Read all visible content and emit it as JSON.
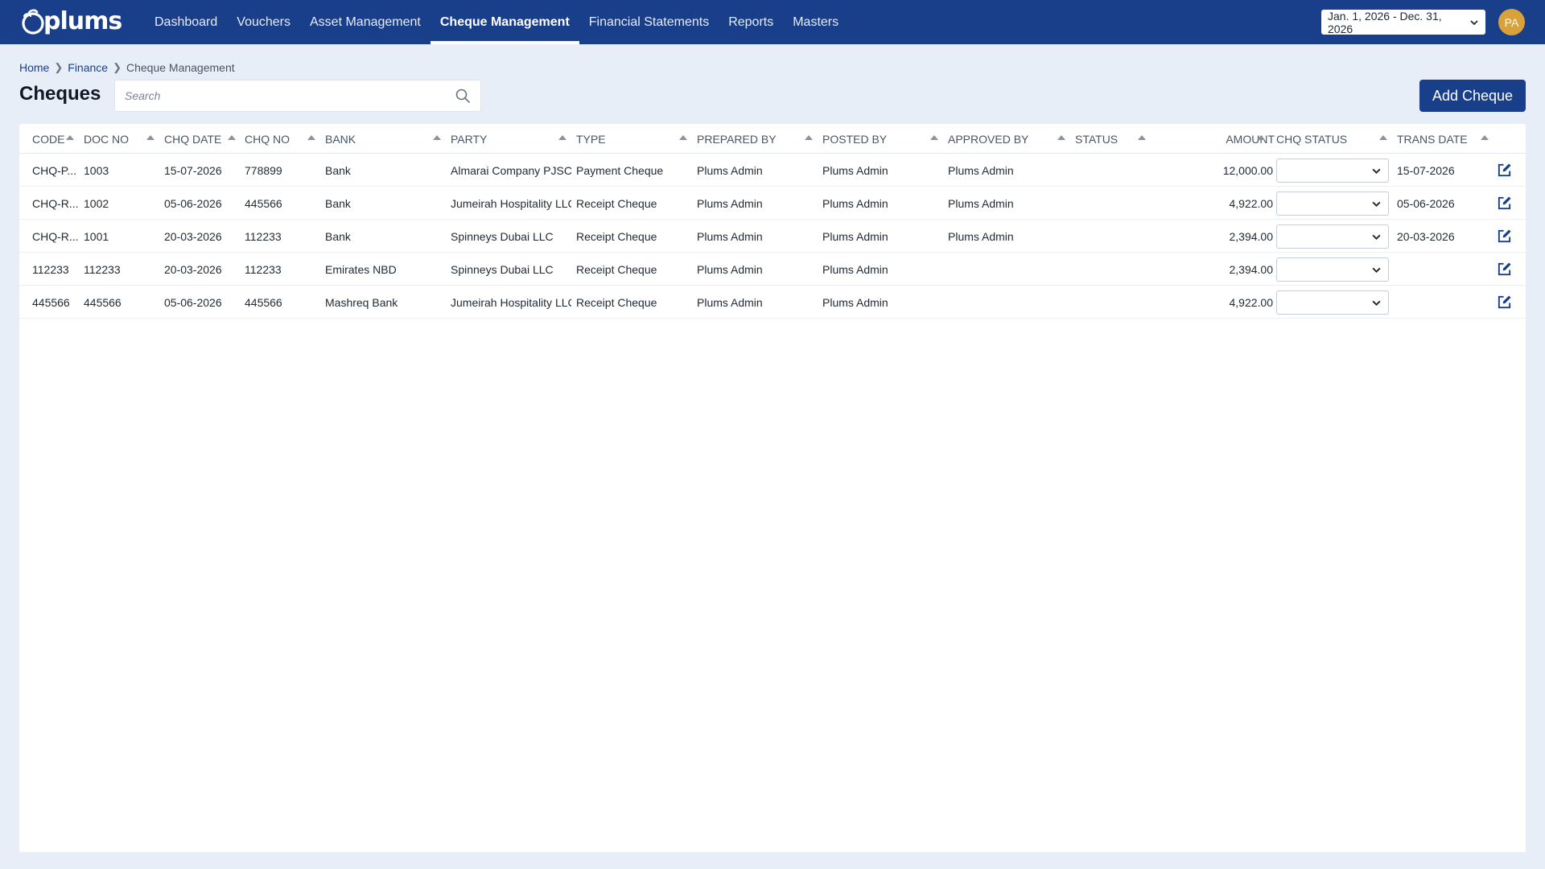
{
  "brand": {
    "name": "plums"
  },
  "nav": {
    "items": [
      {
        "label": "Dashboard",
        "active": false
      },
      {
        "label": "Vouchers",
        "active": false
      },
      {
        "label": "Asset Management",
        "active": false
      },
      {
        "label": "Cheque Management",
        "active": true
      },
      {
        "label": "Financial Statements",
        "active": false
      },
      {
        "label": "Reports",
        "active": false
      },
      {
        "label": "Masters",
        "active": false
      }
    ],
    "date_range": "Jan. 1, 2026 - Dec. 31, 2026",
    "avatar_initials": "PA"
  },
  "breadcrumb": {
    "home": "Home",
    "finance": "Finance",
    "current": "Cheque Management"
  },
  "page": {
    "title": "Cheques",
    "search_placeholder": "Search",
    "add_button": "Add Cheque"
  },
  "table": {
    "columns": [
      "CODE",
      "DOC NO",
      "CHQ DATE",
      "CHQ NO",
      "BANK",
      "PARTY",
      "TYPE",
      "PREPARED BY",
      "POSTED BY",
      "APPROVED BY",
      "STATUS",
      "AMOUNT",
      "CHQ STATUS",
      "TRANS DATE"
    ],
    "rows": [
      {
        "code": "CHQ-P...",
        "doc_no": "1003",
        "chq_date": "15-07-2026",
        "chq_no": "778899",
        "bank": "Bank",
        "party": "Almarai Company PJSC",
        "type": "Payment Cheque",
        "prepared_by": "Plums Admin",
        "posted_by": "Plums Admin",
        "approved_by": "Plums Admin",
        "status": "",
        "amount": "12,000.00",
        "chq_status": "",
        "trans_date": "15-07-2026"
      },
      {
        "code": "CHQ-R...",
        "doc_no": "1002",
        "chq_date": "05-06-2026",
        "chq_no": "445566",
        "bank": "Bank",
        "party": "Jumeirah Hospitality LLC",
        "type": "Receipt Cheque",
        "prepared_by": "Plums Admin",
        "posted_by": "Plums Admin",
        "approved_by": "Plums Admin",
        "status": "",
        "amount": "4,922.00",
        "chq_status": "",
        "trans_date": "05-06-2026"
      },
      {
        "code": "CHQ-R...",
        "doc_no": "1001",
        "chq_date": "20-03-2026",
        "chq_no": "112233",
        "bank": "Bank",
        "party": "Spinneys Dubai LLC",
        "type": "Receipt Cheque",
        "prepared_by": "Plums Admin",
        "posted_by": "Plums Admin",
        "approved_by": "Plums Admin",
        "status": "",
        "amount": "2,394.00",
        "chq_status": "",
        "trans_date": "20-03-2026"
      },
      {
        "code": "112233",
        "doc_no": "112233",
        "chq_date": "20-03-2026",
        "chq_no": "112233",
        "bank": "Emirates NBD",
        "party": "Spinneys Dubai LLC",
        "type": "Receipt Cheque",
        "prepared_by": "Plums Admin",
        "posted_by": "Plums Admin",
        "approved_by": "",
        "status": "",
        "amount": "2,394.00",
        "chq_status": "",
        "trans_date": ""
      },
      {
        "code": "445566",
        "doc_no": "445566",
        "chq_date": "05-06-2026",
        "chq_no": "445566",
        "bank": "Mashreq Bank",
        "party": "Jumeirah Hospitality LLC",
        "type": "Receipt Cheque",
        "prepared_by": "Plums Admin",
        "posted_by": "Plums Admin",
        "approved_by": "",
        "status": "",
        "amount": "4,922.00",
        "chq_status": "",
        "trans_date": ""
      }
    ]
  },
  "icons": {
    "search": "search-icon",
    "edit": "edit-icon",
    "chevron": "chevron-down-icon",
    "sort": "sort-asc-icon",
    "logo": "plums-logo-icon"
  },
  "colors": {
    "primary": "#1a3f8a",
    "background": "#e8eef7",
    "avatar": "#d9a13a"
  }
}
